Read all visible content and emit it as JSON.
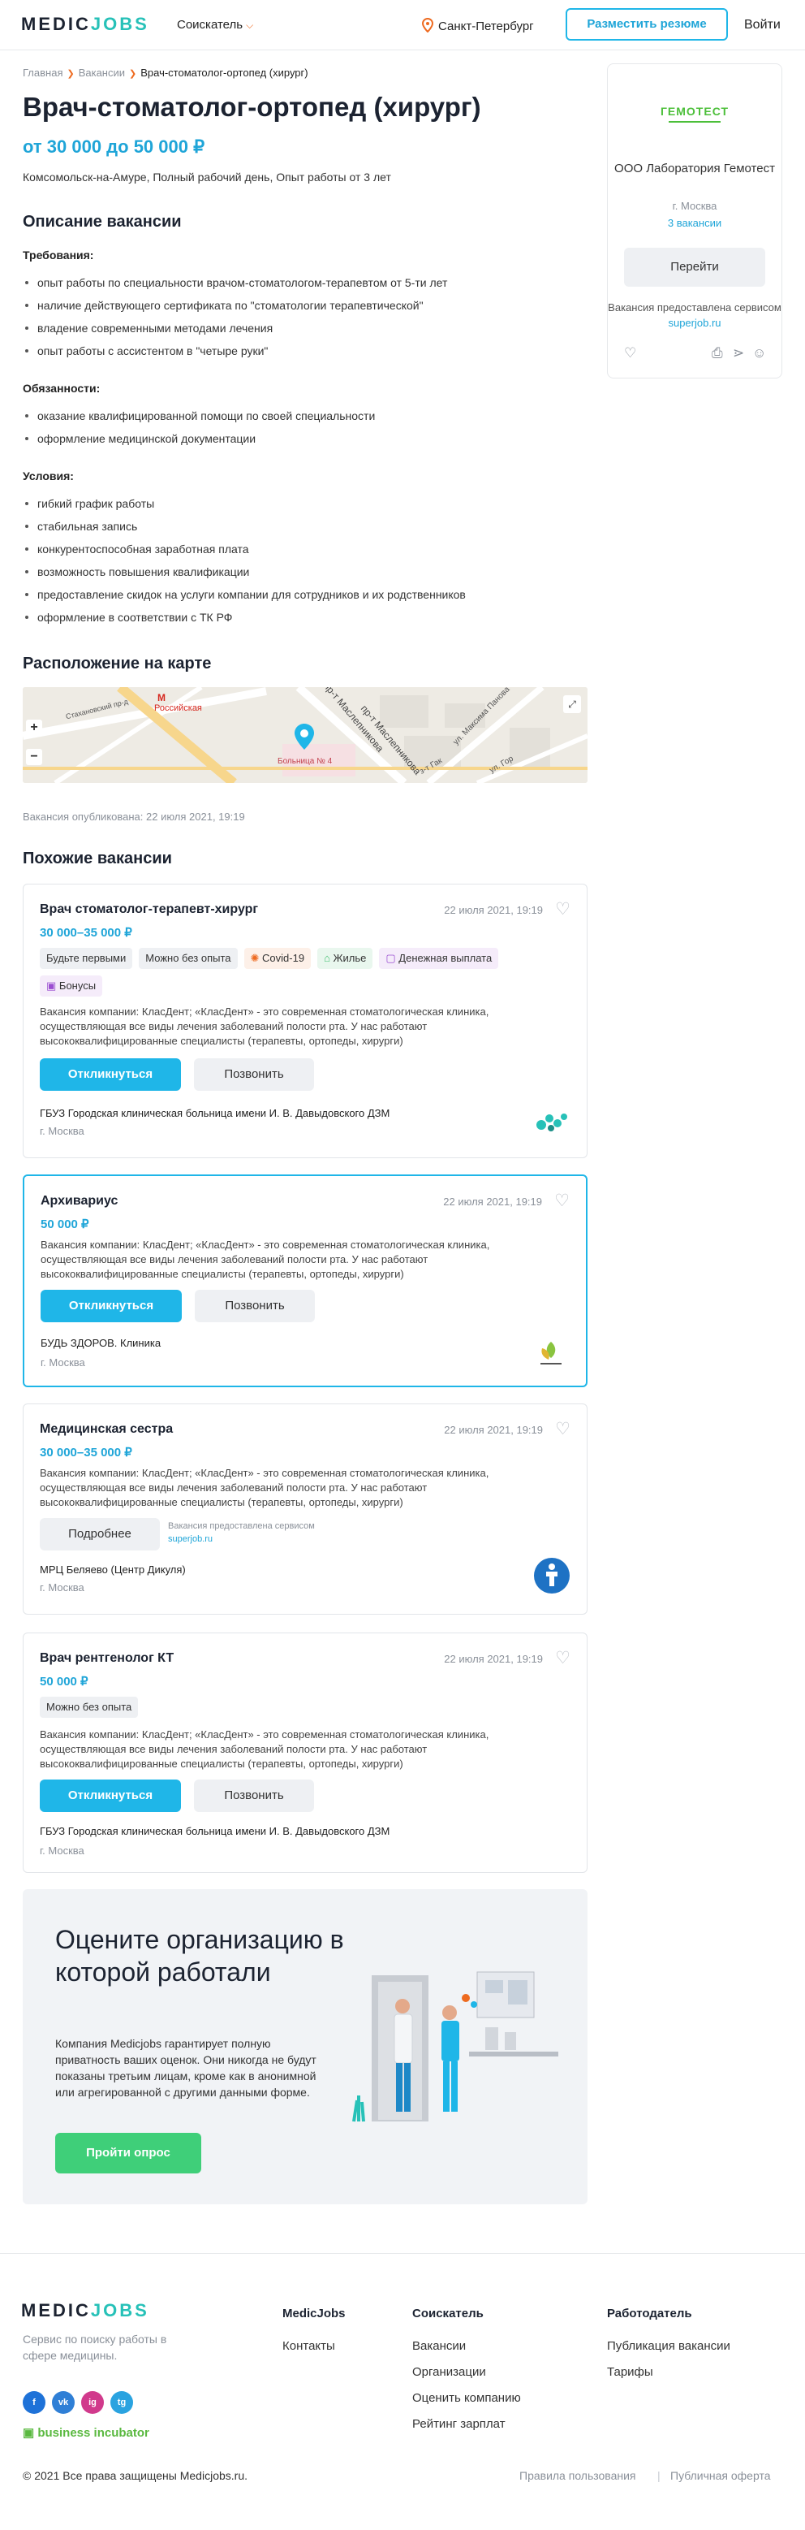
{
  "header": {
    "logo_left": "MEDIC",
    "logo_right": "JOBS",
    "seeker_menu": "Соискатель",
    "city": "Санкт-Петербург",
    "post_resume": "Разместить резюме",
    "login": "Войти"
  },
  "breadcrumb": {
    "home": "Главная",
    "vacancies": "Вакансии",
    "current": "Врач-стоматолог-ортопед (хирург)"
  },
  "vacancy": {
    "title": "Врач-стоматолог-ортопед (хирург)",
    "salary": "от 30 000 до 50 000 ₽",
    "meta": "Комсомольск-на-Амуре, Полный рабочий день, Опыт работы от 3 лет",
    "description_title": "Описание вакансии",
    "requirements_title": "Требования:",
    "requirements": [
      "опыт работы по специальности врачом-стоматологом-терапевтом от 5-ти лет",
      "наличие действующего сертификата по \"стоматологии терапевтической\"",
      "владение современными методами лечения",
      "опыт работы с ассистентом в \"четыре руки\""
    ],
    "duties_title": "Обязанности:",
    "duties": [
      "оказание квалифицированной помощи по своей специальности",
      "оформление медицинской документации"
    ],
    "conditions_title": "Условия:",
    "conditions": [
      "гибкий график работы",
      "стабильная запись",
      "конкурентоспособная заработная плата",
      "возможность повышения квалификации",
      "предоставление скидок на услуги компании для сотрудников и их родственников",
      "оформление в соответствии с ТК РФ"
    ],
    "map_title": "Расположение на карте",
    "published": "Вакансия опубликована: 22 июля 2021, 19:19"
  },
  "map": {
    "metro": "Российская",
    "hospital": "Больница № 4",
    "street1": "Стахановский пр-д",
    "street2": "пр-т Маслепникова",
    "street3": "пр-т Маслепникова",
    "street4": "ул. Максима Панова",
    "street5": "ул. Гор",
    "street6": "з-т Гак",
    "zoom_in": "+",
    "zoom_out": "−"
  },
  "sidebar": {
    "logo_text": "ГЕМОТЕСТ",
    "org_name": "ООО Лаборатория Гемотест",
    "org_city": "г. Москва",
    "org_count": "3 вакансии",
    "go_button": "Перейти",
    "provided": "Вакансия предоставлена сервисом",
    "provider": "superjob.ru"
  },
  "similar": {
    "title": "Похожие вакансии",
    "respond": "Откликнуться",
    "call": "Позвонить",
    "more": "Подробнее",
    "cards": [
      {
        "title": "Врач стоматолог-терапевт-хирург",
        "date": "22 июля 2021, 19:19",
        "salary": "30 000–35 000 ₽",
        "tags": [
          "Будьте первыми",
          "Можно без опыта",
          "Covid-19",
          "Жилье",
          "Денежная выплата",
          "Бонусы"
        ],
        "desc": "Вакансия компании: КласДент; «КласДент» - это современная стоматологическая клиника, осуществляющая все виды лечения заболеваний полости рта. У нас работают высококвалифицированные специалисты (терапевты, ортопеды, хирурги)",
        "company": "ГБУЗ Городская клиническая больница имени И. В. Давыдовского ДЗМ",
        "city": "г. Москва"
      },
      {
        "title": "Архивариус",
        "date": "22 июля 2021, 19:19",
        "salary": "50 000 ₽",
        "desc": "Вакансия компании: КласДент; «КласДент» - это современная стоматологическая клиника, осуществляющая все виды лечения заболеваний полости рта. У нас работают высококвалифицированные специалисты (терапевты, ортопеды, хирурги)",
        "company": "БУДЬ ЗДОРОВ. Клиника",
        "city": "г. Москва"
      },
      {
        "title": "Медицинская сестра",
        "date": "22 июля 2021, 19:19",
        "salary": "30 000–35 000 ₽",
        "desc": "Вакансия компании: КласДент; «КласДент» - это современная стоматологическая клиника, осуществляющая все виды лечения заболеваний полости рта. У нас работают высококвалифицированные специалисты (терапевты, ортопеды, хирурги)",
        "provided": "Вакансия предоставлена сервисом",
        "provider": "superjob.ru",
        "company": "МРЦ Беляево (Центр Дикуля)",
        "city": "г. Москва"
      },
      {
        "title": "Врач рентгенолог КТ",
        "date": "22 июля 2021, 19:19",
        "salary": "50 000 ₽",
        "tags": [
          "Можно без опыта"
        ],
        "desc": "Вакансия компании: КласДент; «КласДент» - это современная стоматологическая клиника, осуществляющая все виды лечения заболеваний полости рта. У нас работают высококвалифицированные специалисты (терапевты, ортопеды, хирурги)",
        "company": "ГБУЗ Городская клиническая больница имени И. В. Давыдовского ДЗМ",
        "city": "г. Москва"
      }
    ]
  },
  "rate": {
    "title": "Оцените организацию в которой работали",
    "text": "Компания Medicjobs гарантирует полную приватность ваших оценок. Они никогда не будут показаны третьим лицам, кроме как в анонимной или агрегированной с другими данными форме.",
    "button": "Пройти опрос"
  },
  "footer": {
    "tagline": "Сервис по поиску работы в сфере медицины.",
    "col1_title": "MedicJobs",
    "col1": [
      "Контакты"
    ],
    "col2_title": "Соискатель",
    "col2": [
      "Вакансии",
      "Организации",
      "Оценить компанию",
      "Рейтинг зарплат"
    ],
    "col3_title": "Работодатель",
    "col3": [
      "Публикация вакансии",
      "Тарифы"
    ],
    "incubator": "business incubator",
    "copyright": "© 2021 Все права защищены Medicjobs.ru.",
    "terms": "Правила пользования",
    "offer": "Публичная оферта",
    "social": [
      "f",
      "vk",
      "ig",
      "tg"
    ]
  },
  "colors": {
    "accent": "#1fb6e8",
    "brand_teal": "#27c1b8",
    "orange": "#ee6a1f",
    "survey": "#3fcf79"
  }
}
